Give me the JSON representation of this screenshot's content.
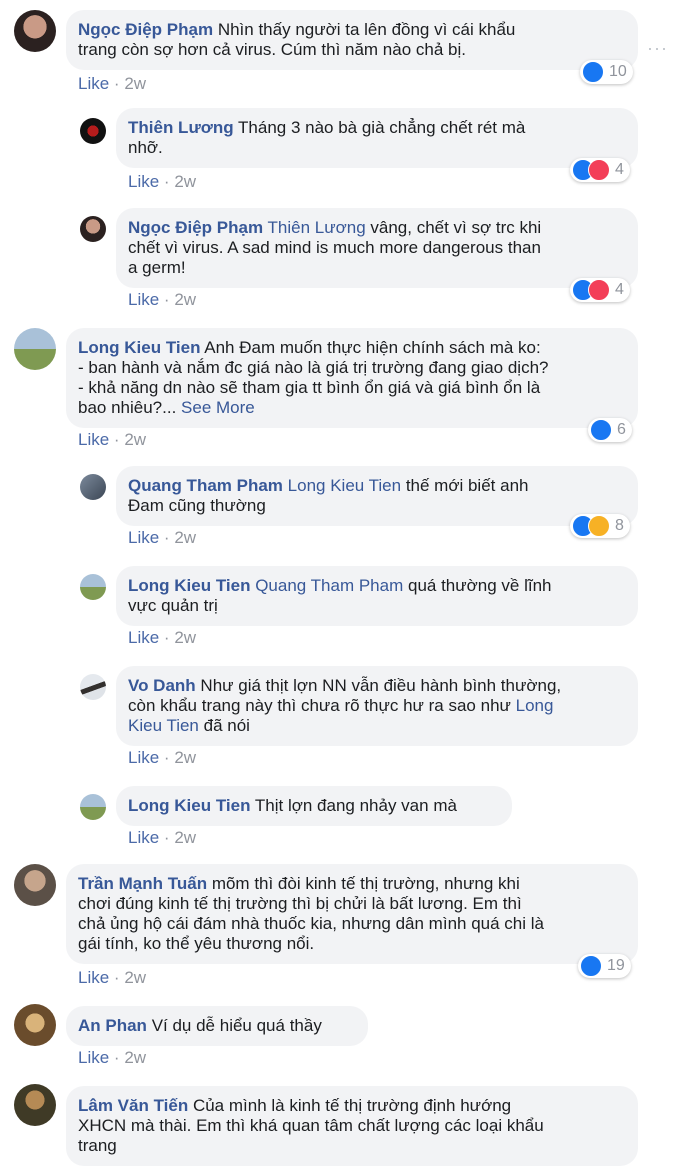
{
  "comments": [
    {
      "id": "c1",
      "author": "Ngọc Điệp Phạm",
      "line1": "Nhìn thấy người ta lên đồng vì cái khẩu",
      "line2": "trang còn sợ hơn cả virus. Cúm thì năm nào chả bị.",
      "like": "Like",
      "time": "2w",
      "reactions": "10"
    },
    {
      "id": "c2",
      "author": "Thiên Lương",
      "line1": "Tháng 3 nào bà già chẳng chết rét mà",
      "line2": "nhỡ.",
      "like": "Like",
      "time": "2w",
      "reactions": "4"
    },
    {
      "id": "c3",
      "author": "Ngọc Điệp Phạm",
      "mention": "Thiên Lương",
      "line1": "vâng, chết vì sợ trc khi",
      "line2": "chết vì virus. A sad mind is much more dangerous than",
      "line3": "a germ!",
      "like": "Like",
      "time": "2w",
      "reactions": "4"
    },
    {
      "id": "c4",
      "author": "Long Kieu Tien",
      "line1": "Anh Đam muốn thực hiện chính sách mà ko:",
      "line2": "- ban hành và nắm đc giá nào là giá trị trường đang giao dịch?",
      "line3": "- khả năng dn nào sẽ tham gia tt bình ổn giá và giá bình ổn là",
      "line4": "bao nhiêu?...",
      "see_more": "See More",
      "like": "Like",
      "time": "2w",
      "reactions": "6"
    },
    {
      "id": "c5",
      "author": "Quang Tham Pham",
      "mention": "Long Kieu Tien",
      "line1": "thế mới biết anh",
      "line2": "Đam cũng thường",
      "like": "Like",
      "time": "2w",
      "reactions": "8"
    },
    {
      "id": "c6",
      "author": "Long Kieu Tien",
      "mention": "Quang Tham Pham",
      "line1": "quá thường về lĩnh",
      "line2": "vực quản trị",
      "like": "Like",
      "time": "2w"
    },
    {
      "id": "c7",
      "author": "Vo Danh",
      "line1": "Như giá thịt lợn NN vẫn điều hành bình thường,",
      "line2": "còn khẩu trang này thì chưa rõ thực hư ra sao như",
      "mention_a": "Long",
      "mention_b": "Kieu Tien",
      "line3": "đã nói",
      "like": "Like",
      "time": "2w"
    },
    {
      "id": "c8",
      "author": "Long Kieu Tien",
      "line1": "Thịt lợn đang nhảy van mà",
      "like": "Like",
      "time": "2w"
    },
    {
      "id": "c9",
      "author": "Trần Mạnh Tuấn",
      "line1": "mõm thì đòi kinh tế thị trường, nhưng khi",
      "line2": "chơi đúng kinh tế thị trường thì bị chửi là bất lương. Em thì",
      "line3": "chả ủng hộ cái đám nhà thuốc kia, nhưng dân mình quá chi là",
      "line4": "gái tính, ko thể yêu thương nổi.",
      "like": "Like",
      "time": "2w",
      "reactions": "19"
    },
    {
      "id": "c10",
      "author": "An Phan",
      "line1": "Ví dụ dễ hiểu quá thầy",
      "like": "Like",
      "time": "2w"
    },
    {
      "id": "c11",
      "author": "Lâm Văn Tiến",
      "line1": "Của mình là kinh tế thị trường định hướng",
      "line2": "XHCN mà thài. Em thì khá quan tâm chất lượng các loại khẩu",
      "line3": "trang"
    }
  ],
  "separator": "·",
  "more_options": "···"
}
